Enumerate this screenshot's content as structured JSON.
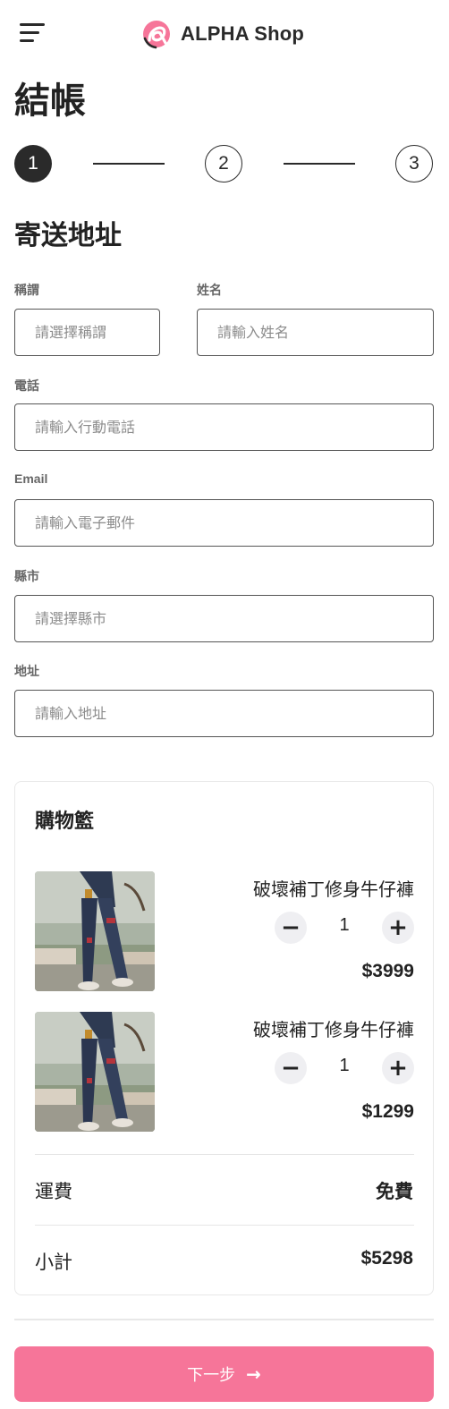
{
  "header": {
    "brand": "ALPHA Shop",
    "menu_icon": "hamburger-menu-icon",
    "logo_icon": "alpha-logo-icon",
    "brand_color": "#f67599"
  },
  "page": {
    "title": "結帳"
  },
  "stepper": {
    "steps": [
      "1",
      "2",
      "3"
    ],
    "active_step": 1
  },
  "shipping": {
    "section_title": "寄送地址",
    "fields": {
      "salutation": {
        "label": "稱謂",
        "placeholder": "請選擇稱謂"
      },
      "name": {
        "label": "姓名",
        "placeholder": "請輸入姓名"
      },
      "phone": {
        "label": "電話",
        "placeholder": "請輸入行動電話"
      },
      "email": {
        "label": "Email",
        "placeholder": "請輸入電子郵件"
      },
      "city": {
        "label": "縣市",
        "placeholder": "請選擇縣市"
      },
      "address": {
        "label": "地址",
        "placeholder": "請輸入地址"
      }
    }
  },
  "cart": {
    "title": "購物籃",
    "items": [
      {
        "name": "破壞補丁修身牛仔褲",
        "quantity": "1",
        "price": "$3999"
      },
      {
        "name": "破壞補丁修身牛仔褲",
        "quantity": "1",
        "price": "$1299"
      }
    ],
    "shipping_label": "運費",
    "shipping_value": "免費",
    "subtotal_label": "小計",
    "subtotal_value": "$5298"
  },
  "actions": {
    "next_label": "下一步",
    "next_icon": "arrow-right-icon",
    "minus_icon": "minus-icon",
    "plus_icon": "plus-icon"
  }
}
